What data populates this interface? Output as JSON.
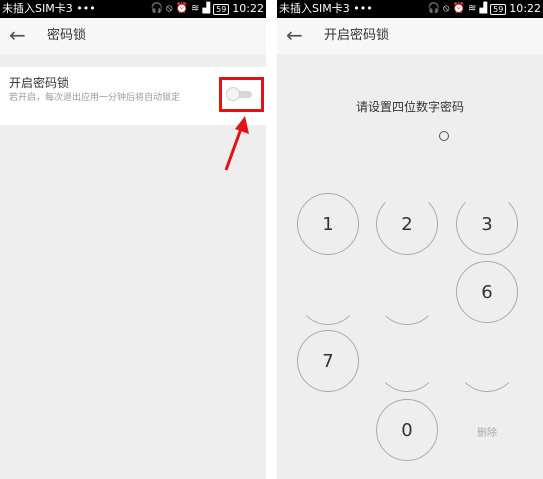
{
  "left_screen": {
    "status": {
      "carrier": "未插入SIM卡3 •••",
      "battery": "59",
      "time": "10:22"
    },
    "appbar": {
      "back_icon": "←",
      "title": "密码锁"
    },
    "setting": {
      "title": "开启密码锁",
      "description": "若开启，每次退出应用一分钟后将自动锁定",
      "toggle_state": "off"
    },
    "annotation": {
      "color": "#e01414"
    }
  },
  "right_screen": {
    "status": {
      "carrier": "未插入SIM卡3 •••",
      "battery": "59",
      "time": "10:22"
    },
    "appbar": {
      "back_icon": "←",
      "title": "开启密码锁"
    },
    "prompt": "请设置四位数字密码",
    "keypad": {
      "key1": "1",
      "key2": "2",
      "key3": "3",
      "key6": "6",
      "key7": "7",
      "key0": "0",
      "delete": "删除"
    }
  }
}
